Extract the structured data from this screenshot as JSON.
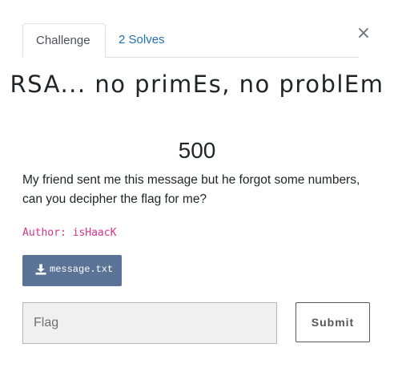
{
  "modal": {
    "close_glyph": "×",
    "tabs": [
      {
        "label": "Challenge",
        "active": true
      },
      {
        "label": "2 Solves",
        "active": false
      }
    ],
    "challenge": {
      "name": "RSA... no primEs, no problEm",
      "value": "500",
      "description": "My friend sent me this message but he forgot some numbers, can you decipher the flag for me?",
      "author": "Author: isHaacK"
    },
    "file": {
      "icon": "download-icon",
      "name": "message.txt"
    },
    "flag_input": {
      "placeholder": "Flag",
      "value": ""
    },
    "submit_label": "Submit"
  },
  "colors": {
    "tab_link": "#1f6fb0",
    "author": "#d6338a",
    "file_button": "#5b7396",
    "input_bg": "#f0f0f0"
  }
}
